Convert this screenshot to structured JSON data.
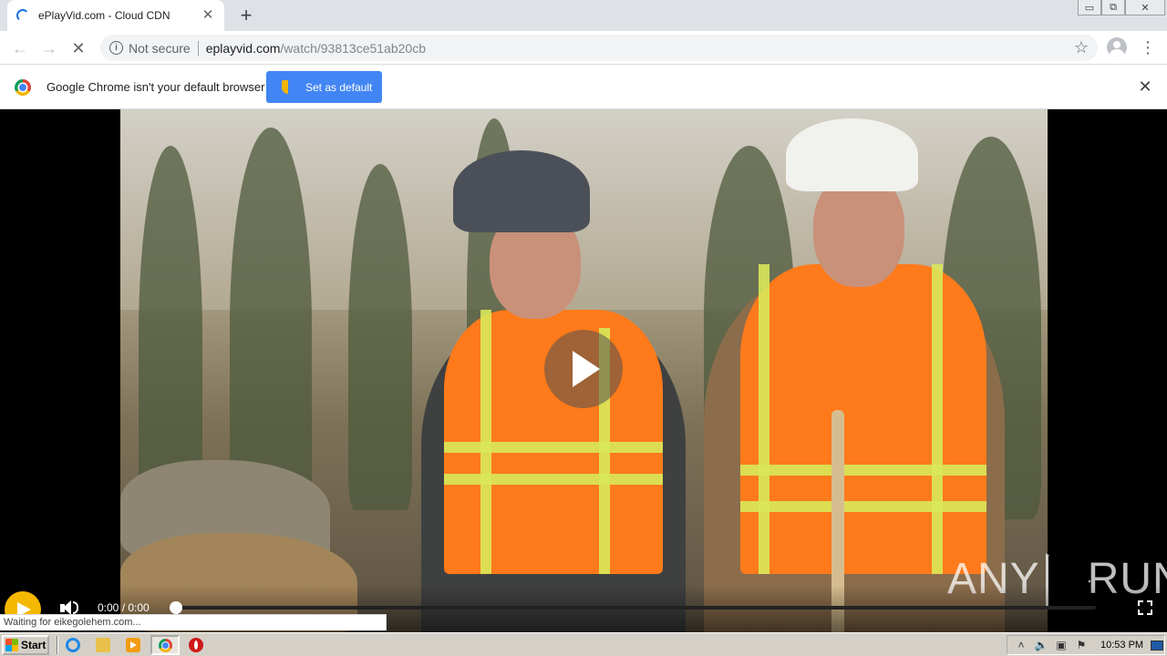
{
  "browser": {
    "tab": {
      "title": "ePlayVid.com - Cloud CDN",
      "close_glyph": "✕"
    },
    "new_tab_glyph": "+",
    "window_controls": {
      "minimize": "▭",
      "restore": "⧉",
      "close": "✕"
    },
    "nav": {
      "back": "←",
      "forward": "→",
      "stop": "✕"
    },
    "omnibox": {
      "security_label": "Not secure",
      "host": "eplayvid.com",
      "path": "/watch/93813ce51ab20cb"
    },
    "star_glyph": "☆",
    "menu_glyph": "⋮"
  },
  "infobar": {
    "message": "Google Chrome isn't your default browser",
    "button_label": "Set as default",
    "close_glyph": "✕"
  },
  "player": {
    "timecode": "0:00 / 0:00",
    "progress_fraction": 0.0,
    "state": "paused"
  },
  "watermark": {
    "left": "ANY",
    "right": "RUN"
  },
  "status_bubble": "Waiting for eikegolehem.com...",
  "taskbar": {
    "start_label": "Start",
    "clock": "10:53 PM",
    "tray_arrow": "˄"
  },
  "colors": {
    "accent_blue": "#4285f4",
    "player_button": "#f5b800",
    "vest_orange": "#ff7a1a"
  }
}
